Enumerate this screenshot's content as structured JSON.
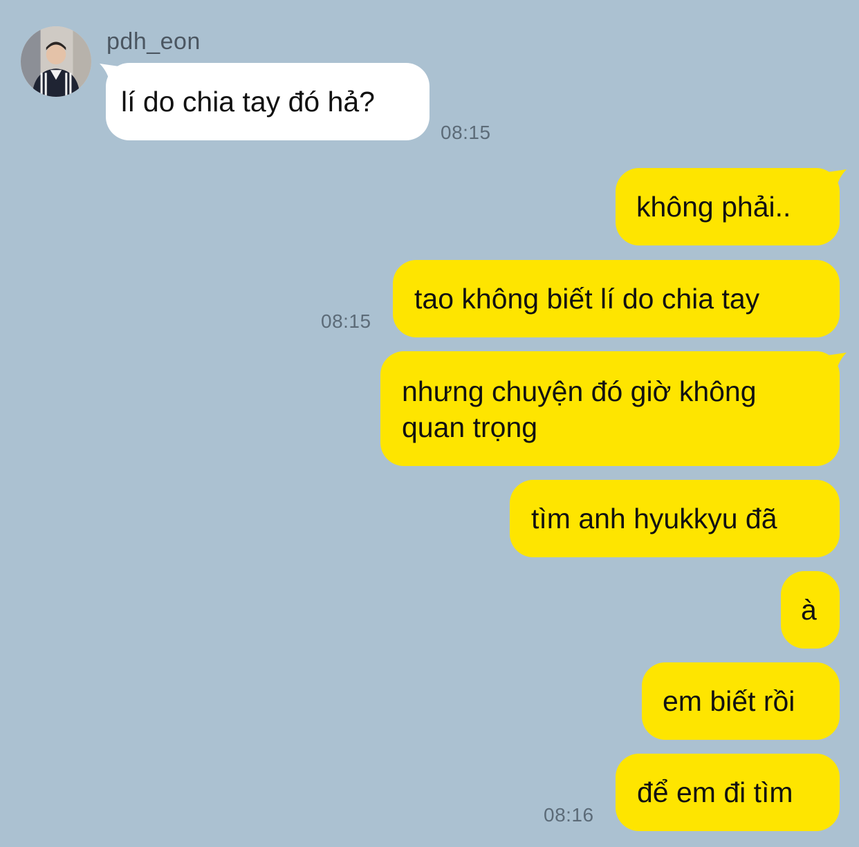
{
  "chat": {
    "sender": {
      "name": "pdh_eon",
      "avatar_icon": "profile-photo"
    },
    "incoming": [
      {
        "text": "lí do chia tay đó hả?",
        "time": "08:15"
      }
    ],
    "outgoing": [
      {
        "text": "không phải.."
      },
      {
        "text": "tao không biết lí do chia tay",
        "time": "08:15"
      },
      {
        "line1": "nhưng chuyện đó giờ không",
        "line2": "quan trọng"
      },
      {
        "text": "tìm anh hyukkyu đã"
      },
      {
        "text": "à"
      },
      {
        "text": "em biết rồi"
      },
      {
        "text": "để em đi tìm",
        "time": "08:16"
      }
    ]
  },
  "colors": {
    "background": "#abc1d1",
    "incoming_bubble": "#ffffff",
    "outgoing_bubble": "#fee500",
    "timestamp": "#5c6b78",
    "sender_name": "#4b5661"
  }
}
